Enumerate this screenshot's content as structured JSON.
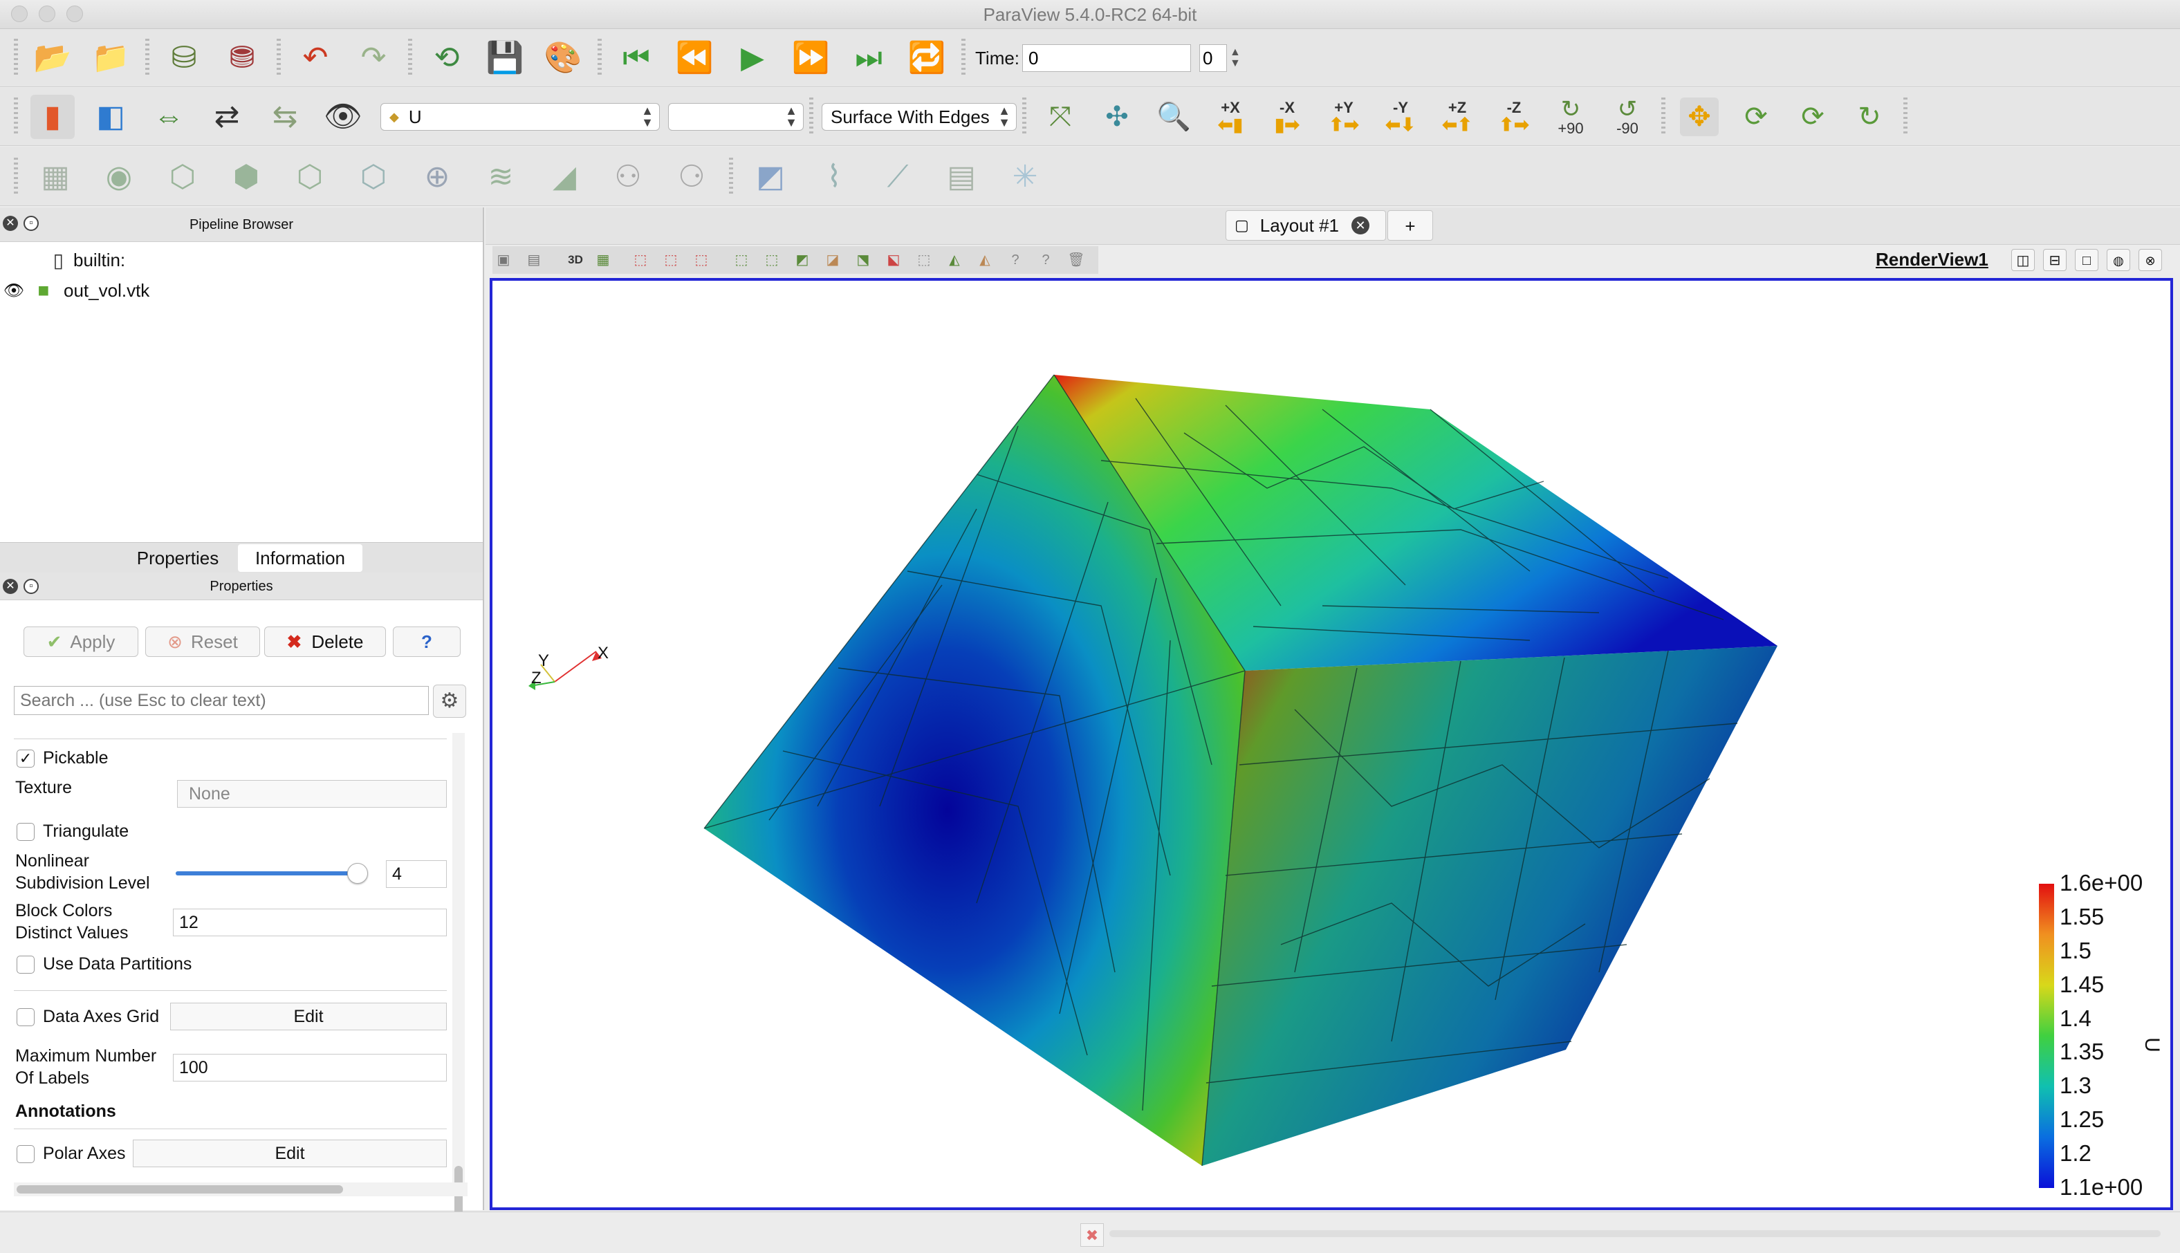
{
  "window": {
    "title": "ParaView 5.4.0-RC2 64-bit"
  },
  "icons": {
    "main_toolbar_1": [
      "open-icon",
      "open-recent-icon",
      "connect-icon",
      "disconnect-icon",
      "undo-icon",
      "redo-icon",
      "reset-session-icon",
      "save-state-icon",
      "color-palette-icon"
    ],
    "vcr": [
      "first-frame-icon",
      "previous-frame-icon",
      "play-icon",
      "next-frame-icon",
      "last-frame-icon",
      "loop-icon"
    ],
    "main_toolbar_2": [
      "color-map-editor-icon",
      "color-legend-icon",
      "rescale-range-icon",
      "rescale-custom-icon",
      "rescale-temporal-icon",
      "rescale-visible-icon"
    ],
    "camera": [
      "reset-camera-icon",
      "zoom-to-data-icon",
      "zoom-to-box-icon"
    ],
    "rotate": [
      "rotate-cw-90-icon",
      "rotate-ccw-90-icon"
    ],
    "extra": [
      "show-center-icon",
      "reset-center-icon",
      "pick-center-icon",
      "interaction-mode-icon"
    ],
    "filters": [
      "calculator-icon",
      "contour-icon",
      "clip-icon",
      "slice-icon",
      "threshold-icon",
      "extract-subset-icon",
      "glyph-icon",
      "stream-tracer-icon",
      "warp-icon",
      "group-datasets-icon",
      "extract-level-icon",
      "select-cells-icon",
      "plot-over-line-icon",
      "histogram-icon",
      "spreadsheet-icon",
      "axes-icon"
    ]
  },
  "toolbar": {
    "time_label": "Time:",
    "time_value": "0",
    "time_index": "0",
    "color_by": "U",
    "component": "",
    "representation": "Surface With Edges",
    "view_dirs": [
      "+X",
      "-X",
      "+Y",
      "-Y",
      "+Z",
      "-Z"
    ],
    "rotate_labels": [
      "+90",
      "-90"
    ]
  },
  "pipeline": {
    "title": "Pipeline Browser",
    "items": [
      {
        "label": "builtin:"
      },
      {
        "label": "out_vol.vtk"
      }
    ]
  },
  "tabs": [
    "Properties",
    "Information"
  ],
  "properties": {
    "title": "Properties",
    "apply": "Apply",
    "reset": "Reset",
    "delete": "Delete",
    "help": "?",
    "search_placeholder": "Search ... (use Esc to clear text)",
    "pickable": "Pickable",
    "texture_label": "Texture",
    "texture_value": "None",
    "triangulate": "Triangulate",
    "nonlinear_label_1": "Nonlinear",
    "nonlinear_label_2": "Subdivision Level",
    "nonlinear_value": "4",
    "nonlinear_slider_fraction": 1.0,
    "block_colors_1": "Block Colors",
    "block_colors_2": "Distinct Values",
    "block_colors_value": "12",
    "use_data_partitions": "Use Data Partitions",
    "data_axes_grid": "Data Axes Grid",
    "edit": "Edit",
    "max_labels_1": "Maximum Number",
    "max_labels_2": "Of Labels",
    "max_labels_value": "100",
    "annotations": "Annotations",
    "polar_axes": "Polar Axes"
  },
  "layout": {
    "tab_label": "Layout #1",
    "add_tab": "+",
    "view_title": "RenderView1",
    "toolbar_3d": "3D"
  },
  "legend": {
    "title": "U",
    "ticks": [
      "1.6e+00",
      "1.55",
      "1.5",
      "1.45",
      "1.4",
      "1.35",
      "1.3",
      "1.25",
      "1.2",
      "1.1e+00"
    ],
    "range": [
      1.1,
      1.6
    ]
  },
  "axes": {
    "x": "X",
    "y": "Y",
    "z": "Z"
  },
  "colors": {
    "render_border": "#2326d6",
    "delete_red": "#d42a1d",
    "help_blue": "#2a62c9"
  }
}
